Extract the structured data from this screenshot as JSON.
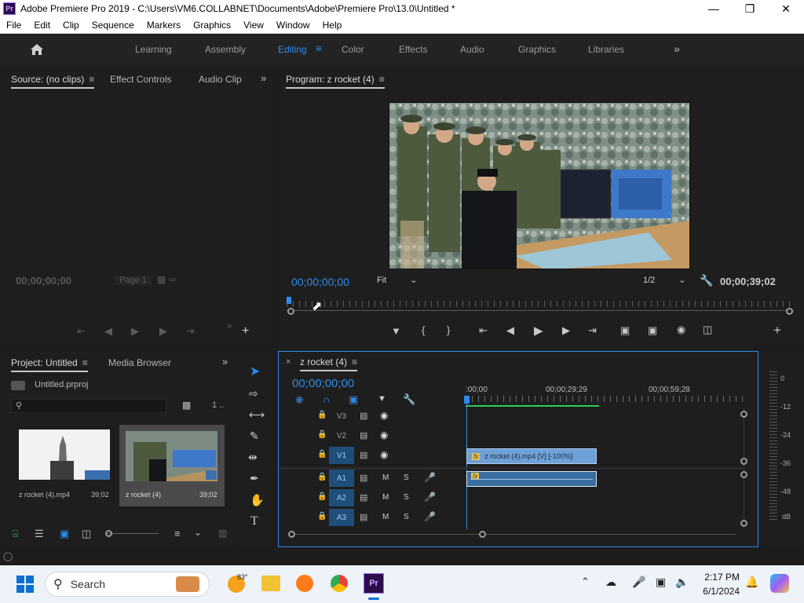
{
  "window": {
    "title": "Adobe Premiere Pro 2019 - C:\\Users\\VM6.COLLABNET\\Documents\\Adobe\\Premiere Pro\\13.0\\Untitled *",
    "app_icon_label": "Pr"
  },
  "menu": [
    "File",
    "Edit",
    "Clip",
    "Sequence",
    "Markers",
    "Graphics",
    "View",
    "Window",
    "Help"
  ],
  "workspaces": {
    "tabs": [
      "Learning",
      "Assembly",
      "Editing",
      "Color",
      "Effects",
      "Audio",
      "Graphics",
      "Libraries"
    ],
    "active": "Editing"
  },
  "source_panel": {
    "tabs": [
      "Source: (no clips)",
      "Effect Controls",
      "Audio Clip"
    ],
    "timecode": "00;00;00;00",
    "page": "Page 1"
  },
  "program_panel": {
    "title": "Program: z rocket (4)",
    "timecode": "00;00;00;00",
    "zoom": "Fit",
    "resolution": "1/2",
    "duration": "00;00;39;02",
    "playhead_fraction": 0.0
  },
  "project_panel": {
    "tabs": [
      "Project: Untitled",
      "Media Browser"
    ],
    "project_file": "Untitled.prproj",
    "item_count": "1 ..",
    "items": [
      {
        "name": "z rocket (4).mp4",
        "duration": "39;02"
      },
      {
        "name": "z rocket (4)",
        "duration": "39;02"
      }
    ]
  },
  "timeline": {
    "sequence_name": "z rocket (4)",
    "timecode": "00;00;00;00",
    "ruler": [
      ":00;00",
      "00;00;29;29",
      "00;00;59;28"
    ],
    "video_tracks": [
      "V3",
      "V2",
      "V1"
    ],
    "audio_tracks": [
      "A1",
      "A2",
      "A3"
    ],
    "mute_label": "M",
    "solo_label": "S",
    "video_clip_label": "z rocket (4).mp4 [V] [-100%]",
    "fx_label": "fx"
  },
  "audio_meter": {
    "scale": [
      "0",
      "-12",
      "-24",
      "-36",
      "-48",
      "dB"
    ]
  },
  "taskbar": {
    "search_placeholder": "Search",
    "weather_temp": "83°",
    "time": "2:17 PM",
    "date": "6/1/2024"
  },
  "colors": {
    "accent_blue": "#2d8ceb",
    "panel_bg": "#1e1e1e",
    "track_selected": "#1f4e7a",
    "video_clip": "#6fa0d6",
    "audio_clip": "#3b6ea0"
  }
}
